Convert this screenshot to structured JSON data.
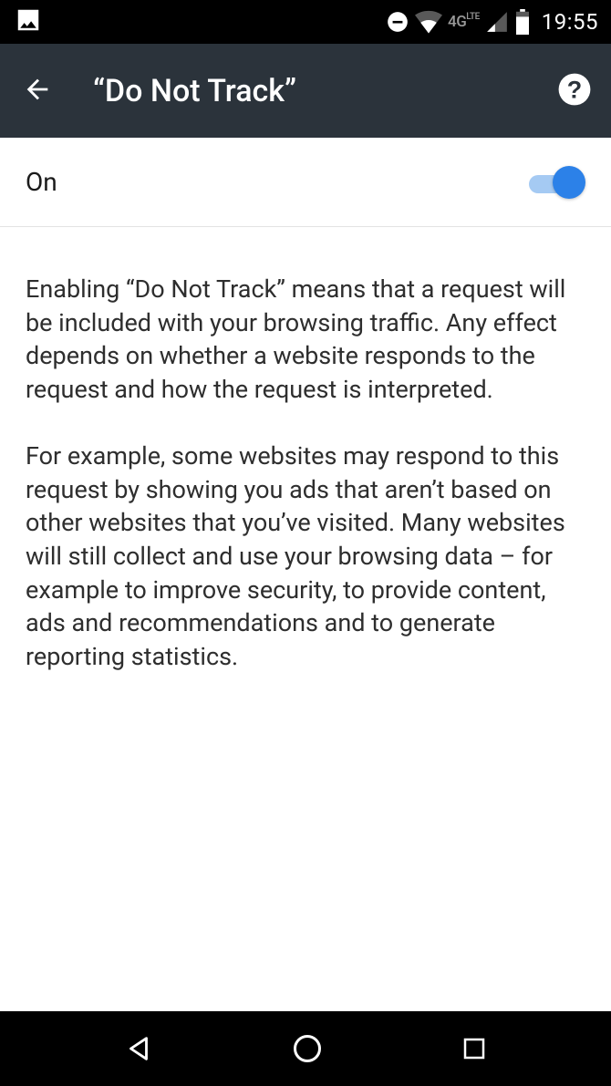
{
  "status": {
    "network_label": "4G",
    "network_sublabel": "LTE",
    "time": "19:55"
  },
  "appbar": {
    "title": "“Do Not Track”"
  },
  "toggle": {
    "label": "On",
    "state": "on"
  },
  "body": {
    "p1": "Enabling “Do Not Track” means that a request will be included with your browsing traffic. Any effect depends on whether a website responds to the request and how the request is interpreted.",
    "p2": "For example, some websites may respond to this request by showing you ads that aren’t based on other websites that you’ve visited. Many websites will still collect and use your browsing data – for example to improve security, to provide content, ads and recommendations and to generate reporting statistics."
  }
}
